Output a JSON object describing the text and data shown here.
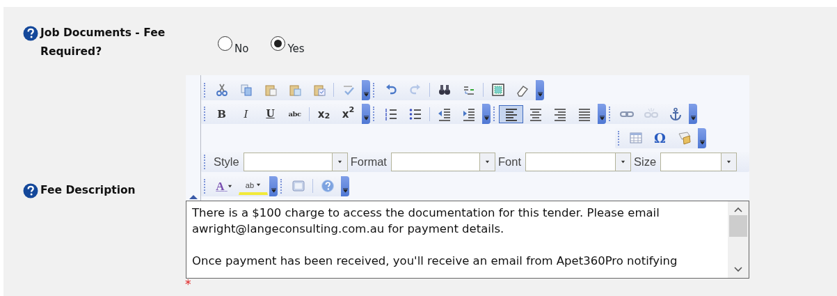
{
  "fields": [
    {
      "kind": "radio",
      "label": "Job Documents - Fee Required?",
      "options": [
        {
          "label": "No",
          "selected": false
        },
        {
          "label": "Yes",
          "selected": true
        }
      ]
    },
    {
      "kind": "editor",
      "label": "Fee Description",
      "required_mark": "*",
      "toolbar": [
        {
          "groups": [
            {
              "buttons": [
                {
                  "kind": "cut",
                  "disabled": false
                },
                {
                  "kind": "copy",
                  "disabled": false
                },
                {
                  "kind": "paste",
                  "disabled": false
                },
                {
                  "kind": "paste-text",
                  "disabled": false
                },
                {
                  "kind": "paste-word",
                  "disabled": false
                },
                {
                  "kind": "separator"
                },
                {
                  "kind": "spellcheck",
                  "disabled": false
                }
              ]
            },
            {
              "buttons": [
                {
                  "kind": "undo",
                  "disabled": false
                },
                {
                  "kind": "redo",
                  "disabled": true
                },
                {
                  "kind": "separator"
                },
                {
                  "kind": "find",
                  "disabled": false
                },
                {
                  "kind": "replace",
                  "disabled": false
                },
                {
                  "kind": "separator"
                },
                {
                  "kind": "select-all",
                  "disabled": false
                },
                {
                  "kind": "eraser",
                  "disabled": false
                }
              ]
            }
          ]
        },
        {
          "groups": [
            {
              "buttons": [
                {
                  "kind": "bold",
                  "glyph": "B",
                  "disabled": false
                },
                {
                  "kind": "italic",
                  "glyph": "I",
                  "disabled": false
                },
                {
                  "kind": "underline",
                  "glyph": "U",
                  "disabled": false
                },
                {
                  "kind": "strike",
                  "glyph": "abc",
                  "disabled": false
                },
                {
                  "kind": "separator"
                },
                {
                  "kind": "subscript",
                  "glyph": "x$_{2}$",
                  "disabled": false
                },
                {
                  "kind": "superscript",
                  "glyph": "x$^{2}$",
                  "disabled": false
                }
              ]
            },
            {
              "buttons": [
                {
                  "kind": "ordered-list",
                  "disabled": false
                },
                {
                  "kind": "bullet-list",
                  "disabled": false
                },
                {
                  "kind": "separator"
                },
                {
                  "kind": "outdent",
                  "disabled": false
                },
                {
                  "kind": "indent",
                  "disabled": false
                }
              ]
            },
            {
              "buttons": [
                {
                  "kind": "align-left",
                  "disabled": false,
                  "selected": true
                },
                {
                  "kind": "align-center",
                  "disabled": false,
                  "selected": false
                },
                {
                  "kind": "align-right",
                  "disabled": false,
                  "selected": false
                },
                {
                  "kind": "justify",
                  "disabled": false,
                  "selected": false
                }
              ]
            },
            {
              "buttons": [
                {
                  "kind": "link",
                  "disabled": false
                },
                {
                  "kind": "unlink",
                  "disabled": true
                },
                {
                  "kind": "anchor",
                  "disabled": false
                }
              ]
            }
          ]
        },
        {
          "groups": [
            {
              "buttons": [
                {
                  "kind": "table",
                  "disabled": false
                },
                {
                  "kind": "special-char",
                  "glyph": "Ω",
                  "disabled": false
                },
                {
                  "kind": "page-break",
                  "disabled": false
                }
              ]
            }
          ]
        },
        {
          "groups": [
            {
              "combos": [
                {
                  "label": "Style"
                },
                {
                  "label": "Format"
                },
                {
                  "label": "Font"
                },
                {
                  "label": "Size"
                }
              ]
            }
          ]
        },
        {
          "groups": [
            {
              "buttons": [
                {
                  "kind": "text-color",
                  "glyph": "A",
                  "disabled": false
                },
                {
                  "kind": "highlight",
                  "glyph": "ab",
                  "disabled": false
                }
              ]
            },
            {
              "buttons": [
                {
                  "kind": "maximize",
                  "disabled": false
                },
                {
                  "kind": "separator"
                },
                {
                  "kind": "help",
                  "disabled": false
                }
              ]
            }
          ]
        }
      ],
      "content": [
        "There is a $100 charge to access the documentation for this tender. Please email awright@langeconsulting.com.au for payment details.",
        "Once payment has been received, you'll receive an email from Apet360Pro notifying"
      ]
    }
  ]
}
